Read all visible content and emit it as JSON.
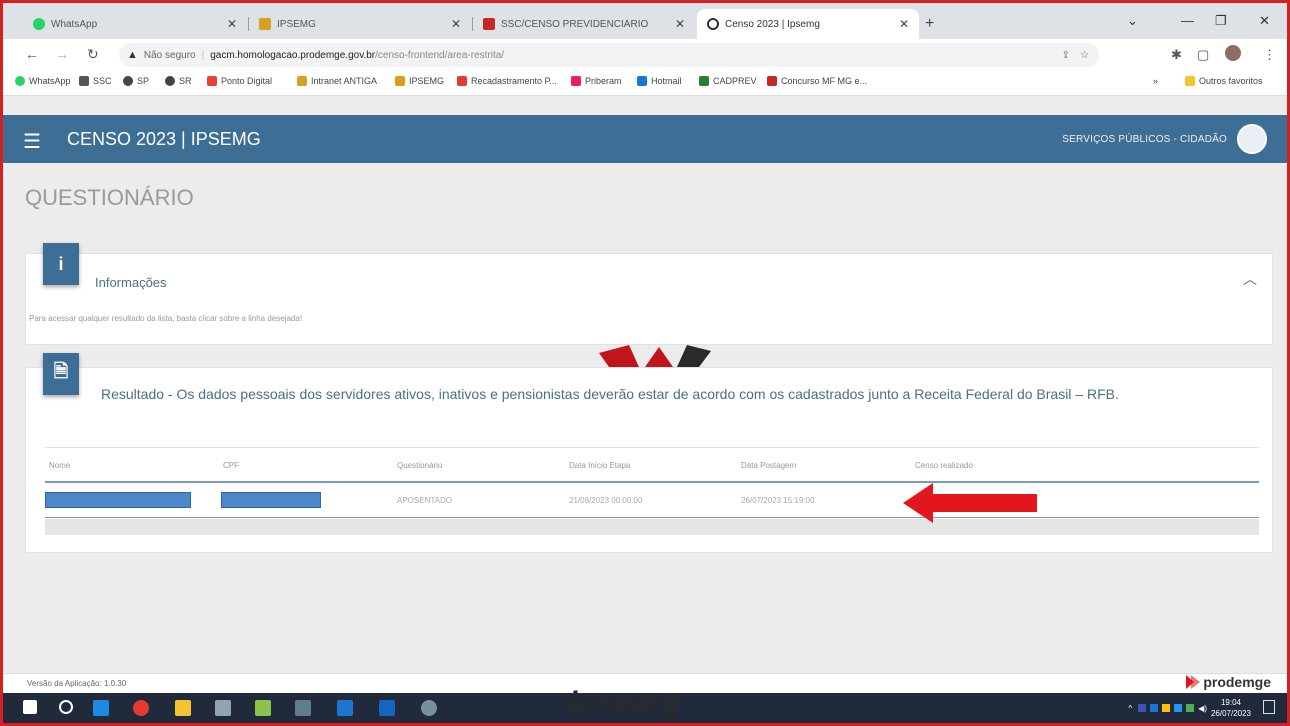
{
  "browser": {
    "tabs": [
      {
        "label": "WhatsApp",
        "active": false,
        "color": "#25d366"
      },
      {
        "label": "IPSEMG",
        "active": false,
        "color": "#d8a020"
      },
      {
        "label": "SSC/CENSO PREVIDENCIARIO",
        "active": false,
        "color": "#c62828"
      },
      {
        "label": "Censo 2023 | Ipsemg",
        "active": true,
        "color": "#333333"
      }
    ],
    "address": {
      "security_label": "Não seguro",
      "host": "gacm.homologacao.prodemge.gov.br",
      "path": "/censo-frontend/area-restrita/"
    },
    "bookmarks": [
      {
        "label": "WhatsApp",
        "color": "#25d366"
      },
      {
        "label": "SSC",
        "color": "#555555"
      },
      {
        "label": "SP",
        "color": "#444444"
      },
      {
        "label": "SR",
        "color": "#444444"
      },
      {
        "label": "Ponto Digital",
        "color": "#ea4335"
      },
      {
        "label": "Intranet ANTIGA",
        "color": "#d8a020"
      },
      {
        "label": "IPSEMG",
        "color": "#d8a020"
      },
      {
        "label": "Recadastramento P...",
        "color": "#e53935"
      },
      {
        "label": "Priberam",
        "color": "#e91e63"
      },
      {
        "label": "Hotmail",
        "color": "#1976d2"
      },
      {
        "label": "CADPREV",
        "color": "#2e7d32"
      },
      {
        "label": "Concurso MF MG e...",
        "color": "#c62828"
      }
    ],
    "other_bookmarks": "Outros favoritos"
  },
  "app": {
    "title": "CENSO 2023 | IPSEMG",
    "services_label": "SERVIÇOS PÚBLICOS - CIDADÃO",
    "header_color": "#3d6f96"
  },
  "page": {
    "title": "QUESTIONÁRIO",
    "info_card": {
      "badge": "i",
      "title": "Informações",
      "text": "Para acessar qualquer resultado da lista, basta clicar sobre a linha desejada!"
    },
    "result_card": {
      "badge": "🗎",
      "title": "Resultado - Os dados pessoais dos servidores ativos, inativos e pensionistas deverão estar de acordo com os cadastrados junto a Receita Federal do Brasil – RFB.",
      "columns": [
        "Nome",
        "CPF",
        "Questionário",
        "Data Início Etapa",
        "Data Postagem",
        "Censo realizado"
      ],
      "row": {
        "questionario": "APOSENTADO",
        "data_inicio": "21/08/2023 00:00:00",
        "data_postagem": "26/07/2023 15:19:00"
      }
    }
  },
  "footer": {
    "version": "Versão da Aplicação: 1.0.30",
    "logo": "prodemge"
  },
  "taskbar": {
    "watermark": "ipsemg",
    "time": "19:04",
    "date": "26/07/2023"
  }
}
